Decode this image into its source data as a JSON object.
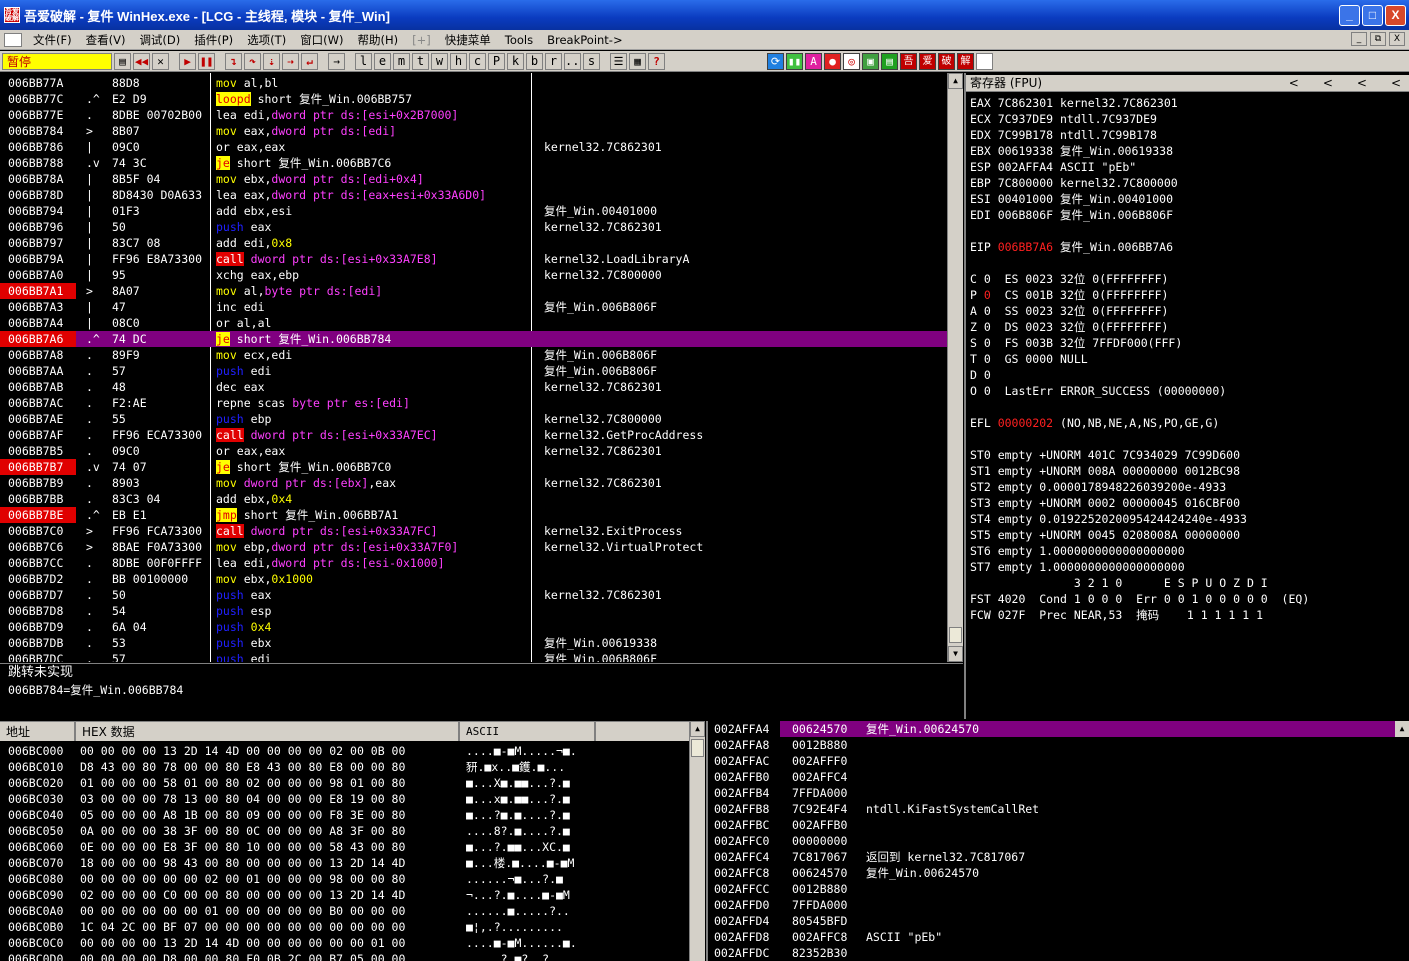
{
  "window": {
    "title": "吾爱破解 - 复件 WinHex.exe - [LCG - 主线程, 模块 - 复件_Win]",
    "icon_text": "吾爱破解",
    "buttons": [
      "_",
      "□",
      "X"
    ]
  },
  "menu": {
    "items": [
      "文件(F)",
      "查看(V)",
      "调试(D)",
      "插件(P)",
      "选项(T)",
      "窗口(W)",
      "帮助(H)",
      "[+]",
      "快捷菜单",
      "Tools",
      "BreakPoint->"
    ],
    "mdi": [
      "_",
      "⧉",
      "X"
    ]
  },
  "toolbar": {
    "status": "暂停",
    "letters": [
      "l",
      "e",
      "m",
      "t",
      "w",
      "h",
      "c",
      "P",
      "k",
      "b",
      "r",
      "...",
      "s"
    ],
    "colors": {
      "pause_bg": "#ffff00",
      "pause_fg": "#c00000"
    }
  },
  "cpu": {
    "rows": [
      {
        "addr": "006BB77A",
        "mark": "",
        "hex": "88D8",
        "mn": "mov",
        "mc": "m-mov",
        "ops": [
          [
            "al,bl",
            ""
          ]
        ],
        "com": ""
      },
      {
        "addr": "006BB77C",
        "mark": ".^",
        "hex": "E2 D9",
        "mn": "loopd",
        "mc": "m-loop",
        "ops": [
          [
            "short 复件_Win.006BB757",
            ""
          ]
        ],
        "com": ""
      },
      {
        "addr": "006BB77E",
        "mark": ".",
        "hex": "8DBE 00702B00",
        "mn": "lea",
        "mc": "",
        "ops": [
          [
            "edi,",
            ""
          ],
          [
            "dword ptr ds:[esi+0x2B7000]",
            "mem"
          ]
        ],
        "com": ""
      },
      {
        "addr": "006BB784",
        "mark": ">",
        "hex": "8B07",
        "mn": "mov",
        "mc": "m-mov",
        "ops": [
          [
            "eax,",
            ""
          ],
          [
            "dword ptr ds:[edi]",
            "mem"
          ]
        ],
        "com": ""
      },
      {
        "addr": "006BB786",
        "mark": "|",
        "hex": "09C0",
        "mn": "or",
        "mc": "",
        "ops": [
          [
            "eax,eax",
            ""
          ]
        ],
        "com": "kernel32.7C862301"
      },
      {
        "addr": "006BB788",
        "mark": ".v",
        "hex": "74 3C",
        "mn": "je",
        "mc": "m-jcc",
        "ops": [
          [
            "short 复件_Win.006BB7C6",
            ""
          ]
        ],
        "com": ""
      },
      {
        "addr": "006BB78A",
        "mark": "|",
        "hex": "8B5F 04",
        "mn": "mov",
        "mc": "m-mov",
        "ops": [
          [
            "ebx,",
            ""
          ],
          [
            "dword ptr ds:[edi+0x4]",
            "mem"
          ]
        ],
        "com": ""
      },
      {
        "addr": "006BB78D",
        "mark": "|",
        "hex": "8D8430 D0A633",
        "mn": "lea",
        "mc": "",
        "ops": [
          [
            "eax,",
            ""
          ],
          [
            "dword ptr ds:[eax+esi+0x33A6D0]",
            "mem"
          ]
        ],
        "com": ""
      },
      {
        "addr": "006BB794",
        "mark": "|",
        "hex": "01F3",
        "mn": "add",
        "mc": "",
        "ops": [
          [
            "ebx,esi",
            ""
          ]
        ],
        "com": "复件_Win.00401000"
      },
      {
        "addr": "006BB796",
        "mark": "|",
        "hex": "50",
        "mn": "push",
        "mc": "m-push",
        "ops": [
          [
            "eax",
            ""
          ]
        ],
        "com": "kernel32.7C862301"
      },
      {
        "addr": "006BB797",
        "mark": "|",
        "hex": "83C7 08",
        "mn": "add",
        "mc": "",
        "ops": [
          [
            "edi,",
            ""
          ],
          [
            "0x8",
            "imm"
          ]
        ],
        "com": ""
      },
      {
        "addr": "006BB79A",
        "mark": "|",
        "hex": "FF96 E8A73300",
        "mn": "call",
        "mc": "m-call",
        "ops": [
          [
            "dword ptr ds:[esi+0x33A7E8]",
            "mem"
          ]
        ],
        "com": "kernel32.LoadLibraryA"
      },
      {
        "addr": "006BB7A0",
        "mark": "|",
        "hex": "95",
        "mn": "xchg",
        "mc": "",
        "ops": [
          [
            "eax,ebp",
            ""
          ]
        ],
        "com": "kernel32.7C800000"
      },
      {
        "addr": "006BB7A1",
        "mark": ">",
        "hex": "8A07",
        "mn": "mov",
        "mc": "m-mov",
        "ops": [
          [
            "al,",
            ""
          ],
          [
            "byte ptr ds:[edi]",
            "mem"
          ]
        ],
        "com": "",
        "bp": true
      },
      {
        "addr": "006BB7A3",
        "mark": "|",
        "hex": "47",
        "mn": "inc",
        "mc": "",
        "ops": [
          [
            "edi",
            ""
          ]
        ],
        "com": "复件_Win.006B806F"
      },
      {
        "addr": "006BB7A4",
        "mark": "|",
        "hex": "08C0",
        "mn": "or",
        "mc": "",
        "ops": [
          [
            "al,al",
            ""
          ]
        ],
        "com": ""
      },
      {
        "addr": "006BB7A6",
        "mark": ".^",
        "hex": "74 DC",
        "mn": "je",
        "mc": "m-jcc",
        "ops": [
          [
            "short 复件_Win.006BB784",
            ""
          ]
        ],
        "com": "",
        "bp": true,
        "sel": true
      },
      {
        "addr": "006BB7A8",
        "mark": ".",
        "hex": "89F9",
        "mn": "mov",
        "mc": "m-mov",
        "ops": [
          [
            "ecx,edi",
            ""
          ]
        ],
        "com": "复件_Win.006B806F"
      },
      {
        "addr": "006BB7AA",
        "mark": ".",
        "hex": "57",
        "mn": "push",
        "mc": "m-push",
        "ops": [
          [
            "edi",
            ""
          ]
        ],
        "com": "复件_Win.006B806F"
      },
      {
        "addr": "006BB7AB",
        "mark": ".",
        "hex": "48",
        "mn": "dec",
        "mc": "",
        "ops": [
          [
            "eax",
            ""
          ]
        ],
        "com": "kernel32.7C862301"
      },
      {
        "addr": "006BB7AC",
        "mark": ".",
        "hex": "F2:AE",
        "mn": "repne scas",
        "mc": "",
        "ops": [
          [
            "byte ptr es:[edi]",
            "mem"
          ]
        ],
        "com": ""
      },
      {
        "addr": "006BB7AE",
        "mark": ".",
        "hex": "55",
        "mn": "push",
        "mc": "m-push",
        "ops": [
          [
            "ebp",
            ""
          ]
        ],
        "com": "kernel32.7C800000"
      },
      {
        "addr": "006BB7AF",
        "mark": ".",
        "hex": "FF96 ECA73300",
        "mn": "call",
        "mc": "m-call",
        "ops": [
          [
            "dword ptr ds:[esi+0x33A7EC]",
            "mem"
          ]
        ],
        "com": "kernel32.GetProcAddress"
      },
      {
        "addr": "006BB7B5",
        "mark": ".",
        "hex": "09C0",
        "mn": "or",
        "mc": "",
        "ops": [
          [
            "eax,eax",
            ""
          ]
        ],
        "com": "kernel32.7C862301"
      },
      {
        "addr": "006BB7B7",
        "mark": ".v",
        "hex": "74 07",
        "mn": "je",
        "mc": "m-jcc",
        "ops": [
          [
            "short 复件_Win.006BB7C0",
            ""
          ]
        ],
        "com": "",
        "bp": true
      },
      {
        "addr": "006BB7B9",
        "mark": ".",
        "hex": "8903",
        "mn": "mov",
        "mc": "m-mov",
        "ops": [
          [
            "dword ptr ds:[ebx]",
            "mem"
          ],
          [
            ",eax",
            ""
          ]
        ],
        "com": "kernel32.7C862301"
      },
      {
        "addr": "006BB7BB",
        "mark": ".",
        "hex": "83C3 04",
        "mn": "add",
        "mc": "",
        "ops": [
          [
            "ebx,",
            ""
          ],
          [
            "0x4",
            "imm"
          ]
        ],
        "com": ""
      },
      {
        "addr": "006BB7BE",
        "mark": ".^",
        "hex": "EB E1",
        "mn": "jmp",
        "mc": "m-jcc",
        "ops": [
          [
            "short 复件_Win.006BB7A1",
            ""
          ]
        ],
        "com": "",
        "bp": true
      },
      {
        "addr": "006BB7C0",
        "mark": ">",
        "hex": "FF96 FCA73300",
        "mn": "call",
        "mc": "m-call",
        "ops": [
          [
            "dword ptr ds:[esi+0x33A7FC]",
            "mem"
          ]
        ],
        "com": "kernel32.ExitProcess"
      },
      {
        "addr": "006BB7C6",
        "mark": ">",
        "hex": "8BAE F0A73300",
        "mn": "mov",
        "mc": "m-mov",
        "ops": [
          [
            "ebp,",
            ""
          ],
          [
            "dword ptr ds:[esi+0x33A7F0]",
            "mem"
          ]
        ],
        "com": "kernel32.VirtualProtect"
      },
      {
        "addr": "006BB7CC",
        "mark": ".",
        "hex": "8DBE 00F0FFFF",
        "mn": "lea",
        "mc": "",
        "ops": [
          [
            "edi,",
            ""
          ],
          [
            "dword ptr ds:[esi-0x1000]",
            "mem"
          ]
        ],
        "com": ""
      },
      {
        "addr": "006BB7D2",
        "mark": ".",
        "hex": "BB 00100000",
        "mn": "mov",
        "mc": "m-mov",
        "ops": [
          [
            "ebx,",
            ""
          ],
          [
            "0x1000",
            "imm"
          ]
        ],
        "com": ""
      },
      {
        "addr": "006BB7D7",
        "mark": ".",
        "hex": "50",
        "mn": "push",
        "mc": "m-push",
        "ops": [
          [
            "eax",
            ""
          ]
        ],
        "com": "kernel32.7C862301"
      },
      {
        "addr": "006BB7D8",
        "mark": ".",
        "hex": "54",
        "mn": "push",
        "mc": "m-push",
        "ops": [
          [
            "esp",
            ""
          ]
        ],
        "com": ""
      },
      {
        "addr": "006BB7D9",
        "mark": ".",
        "hex": "6A 04",
        "mn": "push",
        "mc": "m-push",
        "ops": [
          [
            "0x4",
            "imm"
          ]
        ],
        "com": ""
      },
      {
        "addr": "006BB7DB",
        "mark": ".",
        "hex": "53",
        "mn": "push",
        "mc": "m-push",
        "ops": [
          [
            "ebx",
            ""
          ]
        ],
        "com": "复件_Win.00619338"
      },
      {
        "addr": "006BB7DC",
        "mark": ".",
        "hex": "57",
        "mn": "push",
        "mc": "m-push",
        "ops": [
          [
            "edi",
            ""
          ]
        ],
        "com": "复件_Win.006B806F"
      }
    ]
  },
  "info": {
    "line1": "跳转未实现",
    "line2": "006BB784=复件_Win.006BB784"
  },
  "registers": {
    "header": "寄存器 (FPU)",
    "arrows": [
      "<",
      "<",
      "<",
      "<"
    ],
    "lines": [
      {
        "t": "EAX 7C862301 kernel32.7C862301"
      },
      {
        "t": "ECX 7C937DE9 ntdll.7C937DE9"
      },
      {
        "t": "EDX 7C99B178 ntdll.7C99B178"
      },
      {
        "t": "EBX 00619338 复件_Win.00619338"
      },
      {
        "t": "ESP 002AFFA4 ASCII \"pEb\""
      },
      {
        "t": "EBP 7C800000 kernel32.7C800000"
      },
      {
        "t": "ESI 00401000 复件_Win.00401000"
      },
      {
        "t": "EDI 006B806F 复件_Win.006B806F"
      },
      {
        "t": ""
      },
      {
        "a": "EIP ",
        "r": "006BB7A6",
        "b": " 复件_Win.006BB7A6"
      },
      {
        "t": ""
      },
      {
        "t": "C 0  ES 0023 32位 0(FFFFFFFF)"
      },
      {
        "a": "P ",
        "r": "0",
        "b": "  CS 001B 32位 0(FFFFFFFF)"
      },
      {
        "t": "A 0  SS 0023 32位 0(FFFFFFFF)"
      },
      {
        "t": "Z 0  DS 0023 32位 0(FFFFFFFF)"
      },
      {
        "t": "S 0  FS 003B 32位 7FFDF000(FFF)"
      },
      {
        "t": "T 0  GS 0000 NULL"
      },
      {
        "t": "D 0"
      },
      {
        "t": "O 0  LastErr ERROR_SUCCESS (00000000)"
      },
      {
        "t": ""
      },
      {
        "a": "EFL ",
        "r": "00000202",
        "b": " (NO,NB,NE,A,NS,PO,GE,G)"
      },
      {
        "t": ""
      },
      {
        "t": "ST0 empty +UNORM 401C 7C934029 7C99D600"
      },
      {
        "t": "ST1 empty +UNORM 008A 00000000 0012BC98"
      },
      {
        "t": "ST2 empty 0.0000178948226039200e-4933"
      },
      {
        "t": "ST3 empty +UNORM 0002 00000045 016CBF00"
      },
      {
        "t": "ST4 empty 0.0192252020095424424240e-4933"
      },
      {
        "t": "ST5 empty +UNORM 0045 0208008A 00000000"
      },
      {
        "t": "ST6 empty 1.0000000000000000000"
      },
      {
        "t": "ST7 empty 1.0000000000000000000"
      },
      {
        "t": "               3 2 1 0      E S P U O Z D I"
      },
      {
        "t": "FST 4020  Cond 1 0 0 0  Err 0 0 1 0 0 0 0 0  (EQ)"
      },
      {
        "t": "FCW 027F  Prec NEAR,53  掩码    1 1 1 1 1 1"
      }
    ]
  },
  "dump": {
    "headers": [
      "地址",
      "HEX 数据",
      "ASCII"
    ],
    "rows": [
      {
        "a": "006BC000",
        "h": "00 00 00 00 13 2D 14 4D 00 00 00 00 02 00 0B 00",
        "s": "....■-■M.....¬■."
      },
      {
        "a": "006BC010",
        "h": "D8 43 00 80 78 00 00 80 E8 43 00 80 E8 00 00 80",
        "s": "豜.■x..■鑊.■..."
      },
      {
        "a": "006BC020",
        "h": "01 00 00 00 58 01 00 80 02 00 00 00 98 01 00 80",
        "s": "■...X■.■■...?.■"
      },
      {
        "a": "006BC030",
        "h": "03 00 00 00 78 13 00 80 04 00 00 00 E8 19 00 80",
        "s": "■...x■.■■...?.■"
      },
      {
        "a": "006BC040",
        "h": "05 00 00 00 A8 1B 00 80 09 00 00 00 F8 3E 00 80",
        "s": "■...?■.■....?.■"
      },
      {
        "a": "006BC050",
        "h": "0A 00 00 00 38 3F 00 80 0C 00 00 00 A8 3F 00 80",
        "s": "....8?.■....?.■"
      },
      {
        "a": "006BC060",
        "h": "0E 00 00 00 E8 3F 00 80 10 00 00 00 58 43 00 80",
        "s": "■...?.■■...XC.■"
      },
      {
        "a": "006BC070",
        "h": "18 00 00 00 98 43 00 80 00 00 00 00 13 2D 14 4D",
        "s": "■...楼.■....■-■M"
      },
      {
        "a": "006BC080",
        "h": "00 00 00 00 00 00 02 00 01 00 00 00 98 00 00 80",
        "s": "......¬■...?.■"
      },
      {
        "a": "006BC090",
        "h": "02 00 00 00 C0 00 00 80 00 00 00 00 13 2D 14 4D",
        "s": "¬...?.■....■-■M"
      },
      {
        "a": "006BC0A0",
        "h": "00 00 00 00 00 00 01 00 00 00 00 00 B0 00 00 00",
        "s": "......■.....?.."
      },
      {
        "a": "006BC0B0",
        "h": "1C 04 2C 00 BF 07 00 00 00 00 00 00 00 00 00 00",
        "s": "■¦,.?........."
      },
      {
        "a": "006BC0C0",
        "h": "00 00 00 00 13 2D 14 4D 00 00 00 00 00 00 01 00",
        "s": "....■-■M......■."
      },
      {
        "a": "006BC0D0",
        "h": "00 00 00 00 D8 00 00 80 F0 0B 2C 00 B7 05 00 00",
        "s": ".....?.■?,.?.."
      }
    ]
  },
  "stack": {
    "rows": [
      {
        "a": "002AFFA4",
        "v": "00624570",
        "c": "复件_Win.00624570",
        "sel": true
      },
      {
        "a": "002AFFA8",
        "v": "0012B880",
        "c": ""
      },
      {
        "a": "002AFFAC",
        "v": "002AFFF0",
        "c": ""
      },
      {
        "a": "002AFFB0",
        "v": "002AFFC4",
        "c": ""
      },
      {
        "a": "002AFFB4",
        "v": "7FFDA000",
        "c": ""
      },
      {
        "a": "002AFFB8",
        "v": "7C92E4F4",
        "c": "ntdll.KiFastSystemCallRet"
      },
      {
        "a": "002AFFBC",
        "v": "002AFFB0",
        "c": ""
      },
      {
        "a": "002AFFC0",
        "v": "00000000",
        "c": ""
      },
      {
        "a": "002AFFC4",
        "v": "7C817067",
        "c": "返回到 kernel32.7C817067"
      },
      {
        "a": "002AFFC8",
        "v": "00624570",
        "c": "复件_Win.00624570"
      },
      {
        "a": "002AFFCC",
        "v": "0012B880",
        "c": ""
      },
      {
        "a": "002AFFD0",
        "v": "7FFDA000",
        "c": ""
      },
      {
        "a": "002AFFD4",
        "v": "80545BFD",
        "c": ""
      },
      {
        "a": "002AFFD8",
        "v": "002AFFC8",
        "c": "ASCII \"pEb\""
      },
      {
        "a": "002AFFDC",
        "v": "82352B30",
        "c": ""
      }
    ]
  }
}
